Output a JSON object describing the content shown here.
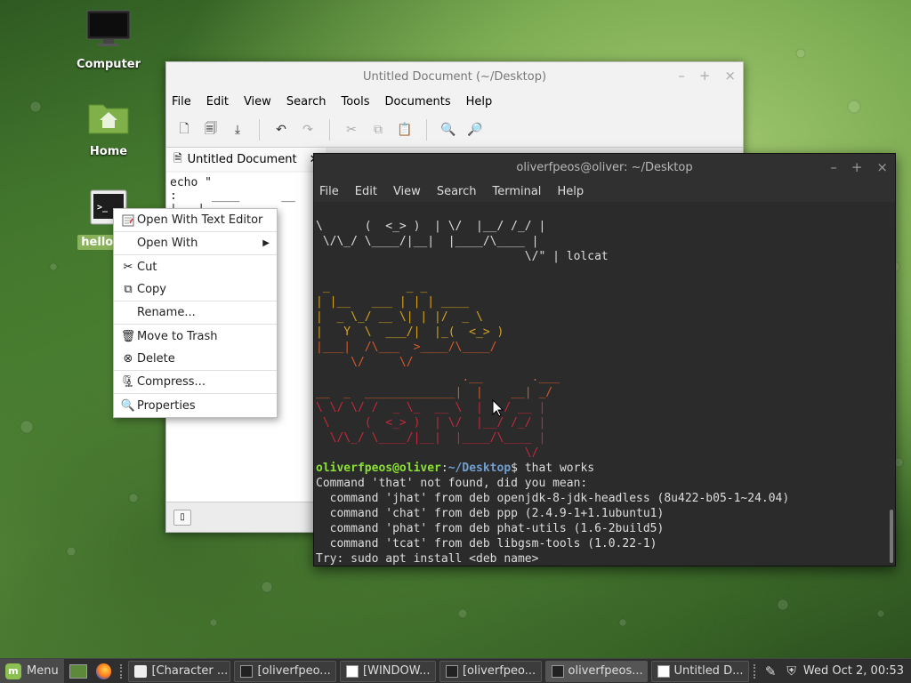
{
  "desktop": {
    "icons": [
      {
        "label": "Computer"
      },
      {
        "label": "Home"
      },
      {
        "label": "hello wo"
      }
    ]
  },
  "gedit": {
    "title": "Untitled Document (~/Desktop)",
    "menu": [
      "File",
      "Edit",
      "View",
      "Search",
      "Tools",
      "Documents",
      "Help"
    ],
    "tab_label": "Untitled Document",
    "content": "echo \"\n:     ____      __ \n|   |\n|   |\n|___|\n _____/\n\n ____\n|    |\\\n|____|"
  },
  "terminal": {
    "title": "oliverfpeos@oliver: ~/Desktop",
    "menu": [
      "File",
      "Edit",
      "View",
      "Search",
      "Terminal",
      "Help"
    ],
    "top_lines": [
      "\\      (  <_> )  | \\/  |__/ /_/ |",
      " \\/\\_/ \\____/|__|  |____/\\____ |",
      "                              \\/\" | lolcat"
    ],
    "art_hello": [
      " _           _ _",
      "| |__   ___ | | | ____",
      "|  _ \\_/ __ \\| | |/  _ \\",
      "|   Y  \\  ___/|  |_(  <_> )",
      "|___|  /\\___  >____/\\____/",
      "     \\/     \\/"
    ],
    "art_world": [
      "                     .__       .___",
      "__  _  _____________|  |    __| _/",
      "\\ \\/ \\/ /  _ \\_  __ \\  |   / __ |",
      " \\     (  <_> )  | \\/  |__/ /_/ |",
      "  \\/\\_/ \\____/|__|  |____/\\____ |",
      "                              \\/"
    ],
    "prompt_user": "oliverfpeos@oliver",
    "prompt_path": "~/Desktop",
    "command": " that works",
    "output": [
      "Command 'that' not found, did you mean:",
      "  command 'jhat' from deb openjdk-8-jdk-headless (8u422-b05-1~24.04)",
      "  command 'chat' from deb ppp (2.4.9-1+1.1ubuntu1)",
      "  command 'phat' from deb phat-utils (1.6-2build5)",
      "  command 'tcat' from deb libgsm-tools (1.0.22-1)",
      "Try: sudo apt install <deb name>"
    ]
  },
  "context_menu": {
    "items": [
      {
        "label": "Open With Text Editor",
        "icon": "text-editor-icon"
      },
      {
        "label": "Open With",
        "icon": "",
        "submenu": true
      },
      {
        "label": "Cut",
        "icon": "scissors-icon"
      },
      {
        "label": "Copy",
        "icon": "copy-icon"
      },
      {
        "label": "Rename...",
        "icon": ""
      },
      {
        "label": "Move to Trash",
        "icon": "trash-icon"
      },
      {
        "label": "Delete",
        "icon": "delete-icon"
      },
      {
        "label": "Compress...",
        "icon": "compress-icon"
      },
      {
        "label": "Properties",
        "icon": "properties-icon"
      }
    ]
  },
  "panel": {
    "menu_label": "Menu",
    "tasks": [
      {
        "label": "[Character ...",
        "icon": "character-map-icon"
      },
      {
        "label": "[oliverfpeo...",
        "icon": "terminal-icon"
      },
      {
        "label": "[WINDOW...",
        "icon": "window-icon"
      },
      {
        "label": "[oliverfpeo...",
        "icon": "terminal-icon"
      },
      {
        "label": "oliverfpeos...",
        "icon": "terminal-icon"
      },
      {
        "label": "Untitled D...",
        "icon": "text-editor-icon"
      }
    ],
    "clock": "Wed Oct  2, 00:53"
  }
}
